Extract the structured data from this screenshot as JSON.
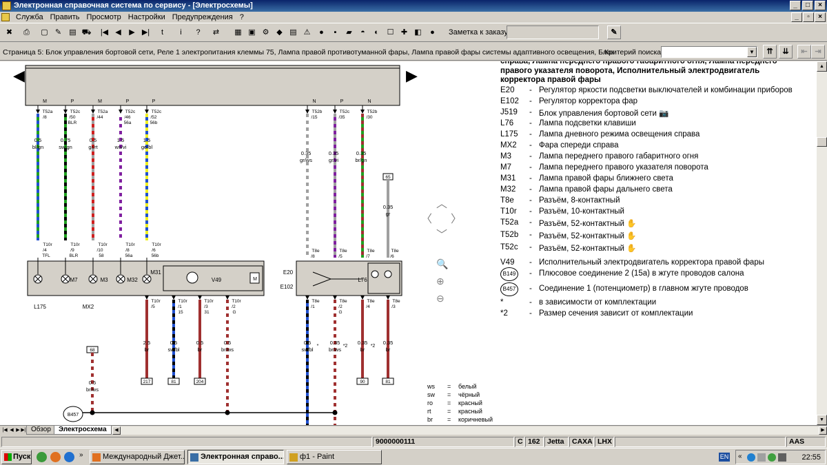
{
  "window": {
    "title": "Электронная справочная система по сервису - [Электросхемы]"
  },
  "menu": [
    "Служба",
    "Править",
    "Просмотр",
    "Настройки",
    "Предупреждения",
    "?"
  ],
  "toolbar": {
    "note_label": "Заметка к заказу:",
    "note_value": ""
  },
  "pagebar": {
    "page_text": "Страница 5: Блок управления бортовой сети, Реле 1 электропитания клеммы 75, Лампа правой противотуманной фары, Лампа правой фары системы адаптивного освещения, Блок",
    "criterion_label": "Критерий поиска:",
    "criterion_value": ""
  },
  "legend": {
    "header": [
      "справа, Лампа переднего правого габаритного огня, Лампа переднего",
      "правого указателя поворота, Исполнительный электродвигатель",
      "корректора правой фары"
    ],
    "items": [
      {
        "code": "E20",
        "dash": "-",
        "text": "Регулятор яркости подсветки выключателей и комбинации приборов"
      },
      {
        "code": "E102",
        "dash": "-",
        "text": "Регулятор корректора фар"
      },
      {
        "code": "J519",
        "dash": "-",
        "text": "Блок управления бортовой сети"
      },
      {
        "code": "L76",
        "dash": "-",
        "text": "Лампа подсветки клавиши"
      },
      {
        "code": "L175",
        "dash": "-",
        "text": "Лампа дневного режима освещения справа"
      },
      {
        "code": "MX2",
        "dash": "-",
        "text": "Фара спереди справа"
      },
      {
        "code": "M3",
        "dash": "-",
        "text": "Лампа переднего правого габаритного огня"
      },
      {
        "code": "M7",
        "dash": "-",
        "text": "Лампа переднего правого указателя поворота"
      },
      {
        "code": "M31",
        "dash": "-",
        "text": "Лампа правой фары ближнего света"
      },
      {
        "code": "M32",
        "dash": "-",
        "text": "Лампа правой фары дальнего света"
      },
      {
        "code": "T8e",
        "dash": "-",
        "text": "Разъём, 8-контактный"
      },
      {
        "code": "T10r",
        "dash": "-",
        "text": "Разъём, 10-контактный"
      },
      {
        "code": "T52a",
        "dash": "-",
        "text": "Разъём, 52-контактный"
      },
      {
        "code": "T52b",
        "dash": "-",
        "text": "Разъём, 52-контактный"
      },
      {
        "code": "T52c",
        "dash": "-",
        "text": "Разъём, 52-контактный"
      },
      {
        "code": "V49",
        "dash": "-",
        "text": "Исполнительный электродвигатель корректора правой фары"
      },
      {
        "code": "B149",
        "dash": "-",
        "text": "Плюсовое соединение 2 (15a) в жгуте проводов салона"
      },
      {
        "code": "B457",
        "dash": "-",
        "text": "Соединение 1 (потенциометр) в главном жгуте проводов"
      },
      {
        "code": "*",
        "dash": "-",
        "text": "в зависимости от комплектации"
      },
      {
        "code": "*2",
        "dash": "-",
        "text": "Размер сечения зависит от комплектации"
      }
    ]
  },
  "color_legend": [
    {
      "k": "ws",
      "e": "=",
      "v": "белый"
    },
    {
      "k": "sw",
      "e": "=",
      "v": "чёрный"
    },
    {
      "k": "ro",
      "e": "=",
      "v": "красный"
    },
    {
      "k": "rt",
      "e": "=",
      "v": "красный"
    },
    {
      "k": "br",
      "e": "=",
      "v": "коричневый"
    }
  ],
  "diagram": {
    "top_wires": [
      {
        "pin": "M",
        "conn": "T52a",
        "num": "/8",
        "extra": "",
        "size": "0.5",
        "col": "bl/gn",
        "bot": "T10r",
        "bnum": "/4",
        "bextra": "TFL",
        "c1": "#2050d0",
        "c2": "#20a020"
      },
      {
        "pin": "P",
        "conn": "T52c",
        "num": "/50",
        "extra": "BLR",
        "size": "0.75",
        "col": "sw/gn",
        "bot": "T10r",
        "bnum": "/9",
        "bextra": "BLR",
        "c1": "#000000",
        "c2": "#20a020"
      },
      {
        "pin": "M",
        "conn": "T52a",
        "num": "/44",
        "extra": "",
        "size": "0.5",
        "col": "gr/rt",
        "bot": "T10r",
        "bnum": "/10",
        "bextra": "58",
        "c1": "#a0a0a0",
        "c2": "#d02020"
      },
      {
        "pin": "P",
        "conn": "T52c",
        "num": "/46",
        "extra": "56a",
        "size": "1.5",
        "col": "ws/vi",
        "bot": "T10r",
        "bnum": "/8",
        "bextra": "56a",
        "c1": "#ffffff",
        "c2": "#8020a0"
      },
      {
        "pin": "P",
        "conn": "T52c",
        "num": "/52",
        "extra": "56b",
        "size": "1.5",
        "col": "ge/bl",
        "bot": "T10r",
        "bnum": "/6",
        "bextra": "56b",
        "c1": "#f0f020",
        "c2": "#2050d0"
      }
    ],
    "right_wires": [
      {
        "pin": "N",
        "conn": "T52b",
        "num": "/15",
        "size": "0.35",
        "col": "gr/ws",
        "bot": "T8e",
        "bnum": "/8",
        "c1": "#a0a0a0",
        "c2": "#ffffff"
      },
      {
        "pin": "P",
        "conn": "T52c",
        "num": "/35",
        "size": "0.35",
        "col": "gr/vi",
        "bot": "T8e",
        "bnum": "/5",
        "c1": "#a0a0a0",
        "c2": "#8020a0"
      },
      {
        "pin": "N",
        "conn": "T52b",
        "num": "/30",
        "size": "0.35",
        "col": "br/gn",
        "bot": "T8e",
        "bnum": "/7",
        "c1": "#a03030",
        "c2": "#20a020"
      }
    ],
    "bottom_wires": [
      {
        "conn": "T10r",
        "num": "/5",
        "extra": "",
        "size": "2.5",
        "col": "br",
        "end": "217",
        "c1": "#a03030",
        "c2": "#a03030"
      },
      {
        "conn": "T10r",
        "num": "/1",
        "extra": "15",
        "size": "0.5",
        "col": "sw/bl",
        "end": "81",
        "c1": "#000000",
        "c2": "#2050d0"
      },
      {
        "conn": "T10r",
        "num": "/3",
        "extra": "31",
        "size": "0.5",
        "col": "br",
        "end": "204",
        "c1": "#a03030",
        "c2": "#a03030"
      },
      {
        "conn": "T10r",
        "num": "/2",
        "extra": "G",
        "size": "0.5",
        "col": "br/ws",
        "end": "",
        "c1": "#a03030",
        "c2": "#ffffff"
      }
    ],
    "right_bottom_wires": [
      {
        "conn": "T8e",
        "num": "/1",
        "size": "0.5",
        "col": "sw/bl",
        "mark": "*",
        "end": "",
        "c1": "#000000",
        "c2": "#2050d0"
      },
      {
        "conn": "T8e",
        "num": "/2",
        "extra": "G",
        "size": "0.35",
        "col": "br/ws",
        "mark": "*2",
        "end": "",
        "c1": "#a03030",
        "c2": "#ffffff"
      },
      {
        "conn": "T8e",
        "num": "/4",
        "size": "0.35",
        "col": "br",
        "mark": "*2",
        "end": "90",
        "c1": "#a03030",
        "c2": "#a03030"
      },
      {
        "conn": "T8e",
        "num": "/3",
        "size": "0.35",
        "col": "br",
        "mark": "",
        "end": "81",
        "c1": "#a03030",
        "c2": "#a03030"
      }
    ],
    "labels": {
      "l175": "L175",
      "mx2": "MX2",
      "m7": "M7",
      "m3": "M3",
      "m32": "M32",
      "m31": "M31",
      "v49": "V49",
      "e20": "E20",
      "e102": "E102",
      "l76": "L76",
      "b457": "B457",
      "w68": "68",
      "w68_size": "0.5",
      "w68_col": "br/ws",
      "w65": "65",
      "w65_size": "0.35",
      "w65_col": "gr",
      "t8e6": "T8e",
      "t8e6_num": "/6"
    }
  },
  "sheet_tabs": [
    "Обзор",
    "Электросхема"
  ],
  "statusbar": [
    "9000000111",
    "C",
    "162",
    "Jetta",
    "CAXA",
    "LHX",
    "AAS"
  ],
  "taskbar": {
    "start": "Пуск",
    "tasks": [
      "Международный Джет...",
      "Электронная справо...",
      "ф1 - Paint"
    ],
    "lang": "EN",
    "clock": "22:55"
  }
}
